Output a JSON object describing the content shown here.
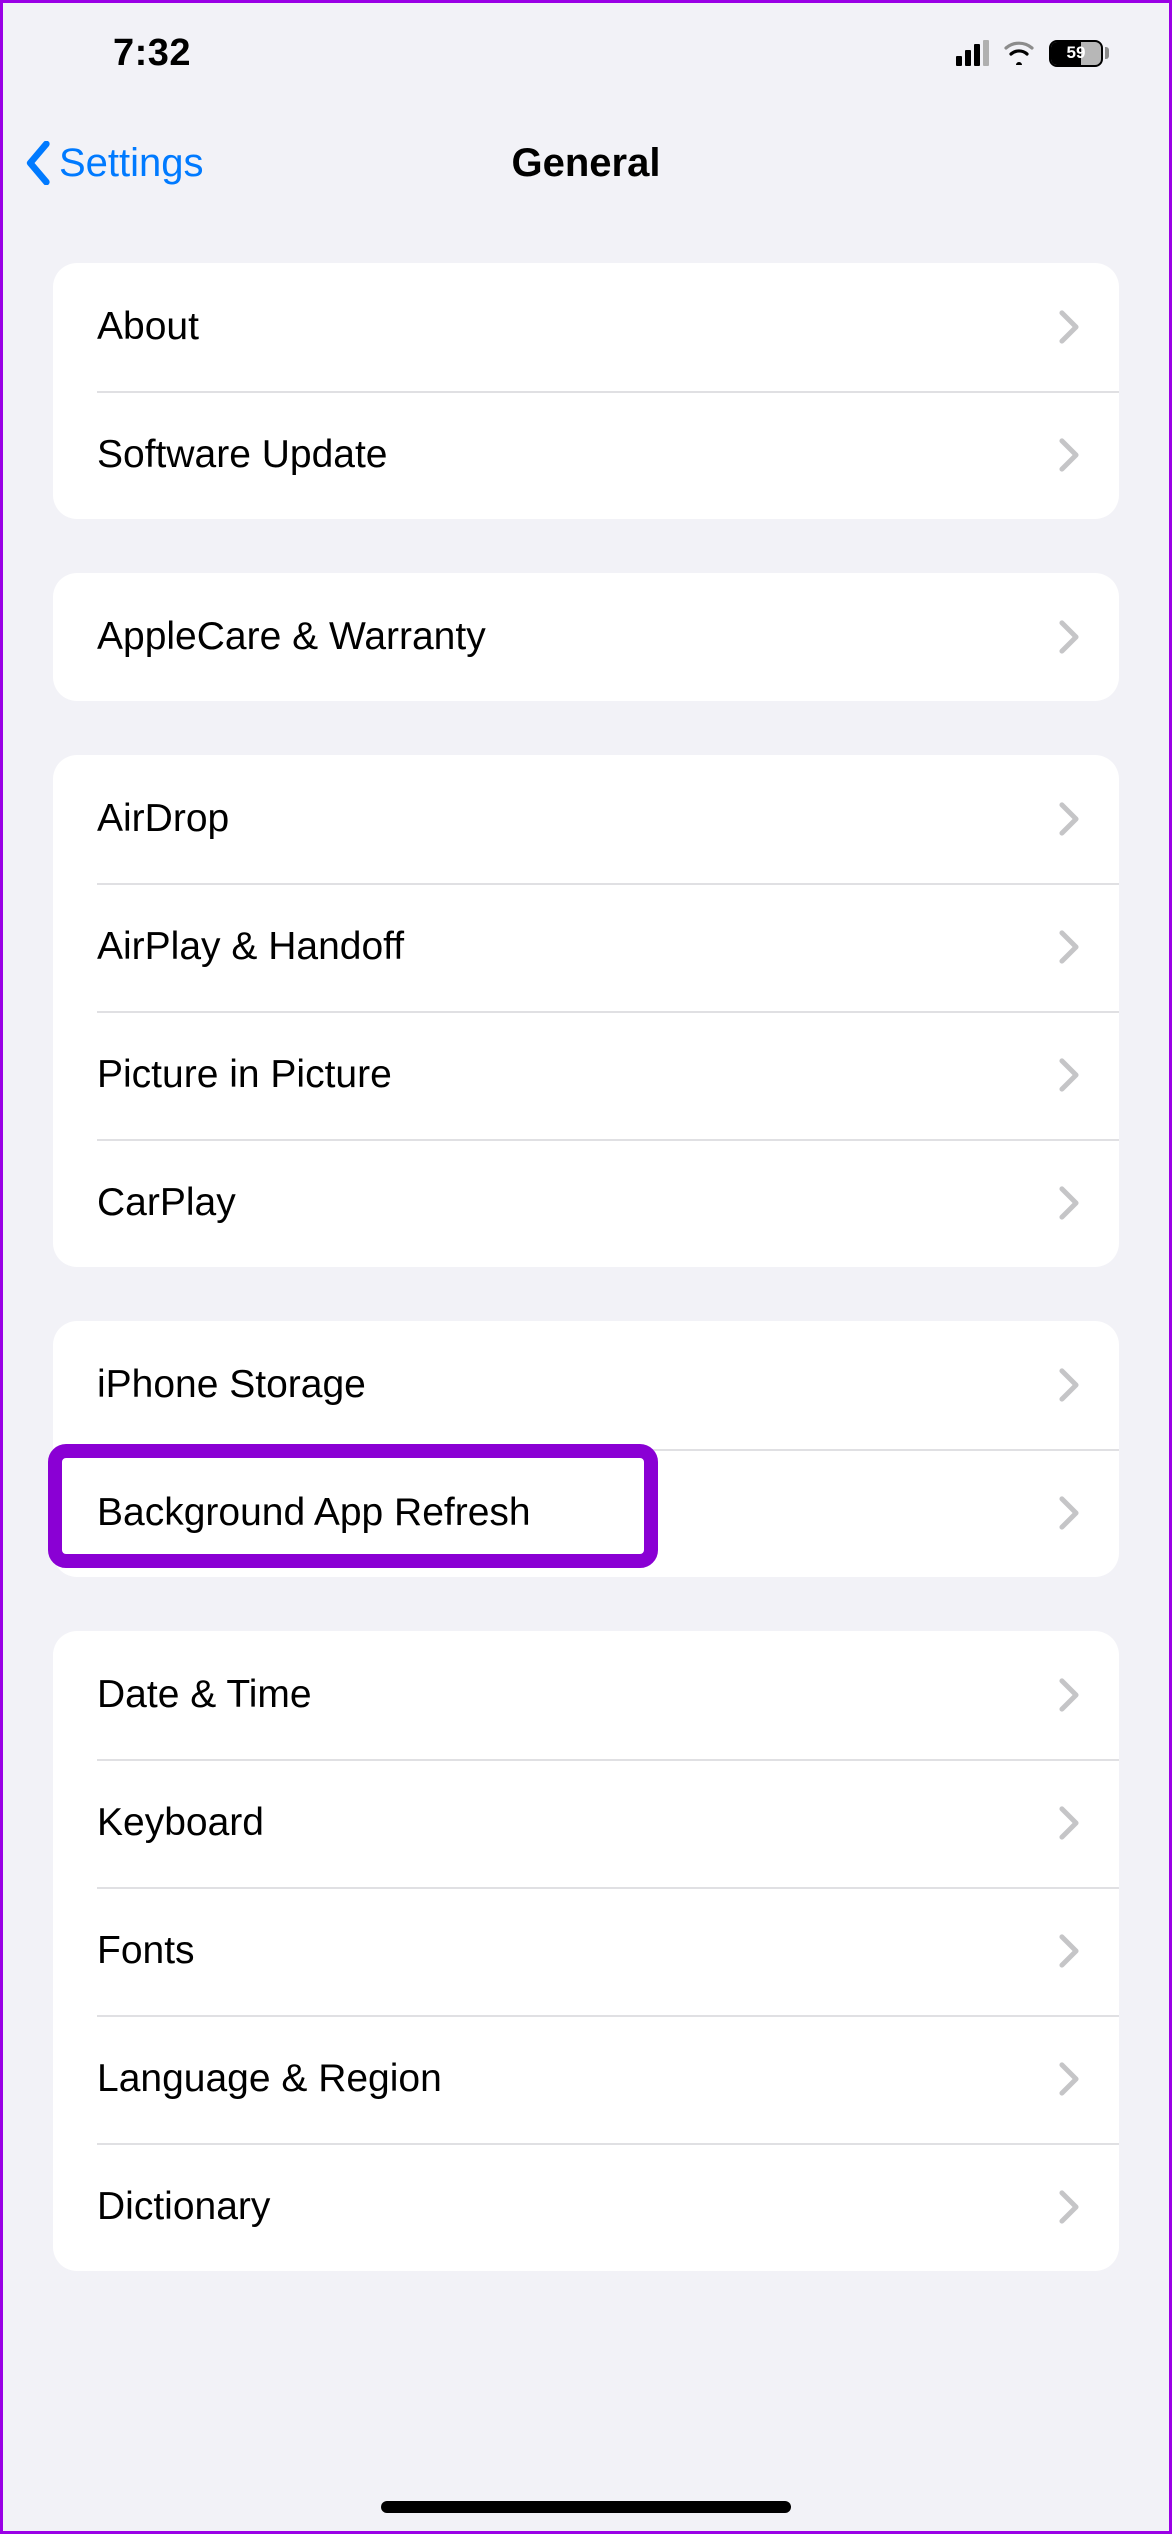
{
  "status": {
    "time": "7:32",
    "battery_percent": "59"
  },
  "nav": {
    "back_label": "Settings",
    "title": "General"
  },
  "groups": [
    {
      "rows": [
        {
          "key": "about",
          "label": "About"
        },
        {
          "key": "software-update",
          "label": "Software Update"
        }
      ]
    },
    {
      "rows": [
        {
          "key": "applecare-warranty",
          "label": "AppleCare & Warranty"
        }
      ]
    },
    {
      "rows": [
        {
          "key": "airdrop",
          "label": "AirDrop"
        },
        {
          "key": "airplay-handoff",
          "label": "AirPlay & Handoff"
        },
        {
          "key": "picture-in-picture",
          "label": "Picture in Picture"
        },
        {
          "key": "carplay",
          "label": "CarPlay"
        }
      ]
    },
    {
      "rows": [
        {
          "key": "iphone-storage",
          "label": "iPhone Storage"
        },
        {
          "key": "background-app-refresh",
          "label": "Background App Refresh",
          "highlighted": true
        }
      ]
    },
    {
      "rows": [
        {
          "key": "date-time",
          "label": "Date & Time"
        },
        {
          "key": "keyboard",
          "label": "Keyboard"
        },
        {
          "key": "fonts",
          "label": "Fonts"
        },
        {
          "key": "language-region",
          "label": "Language & Region"
        },
        {
          "key": "dictionary",
          "label": "Dictionary"
        }
      ]
    }
  ],
  "highlight_color": "#8a00d4"
}
